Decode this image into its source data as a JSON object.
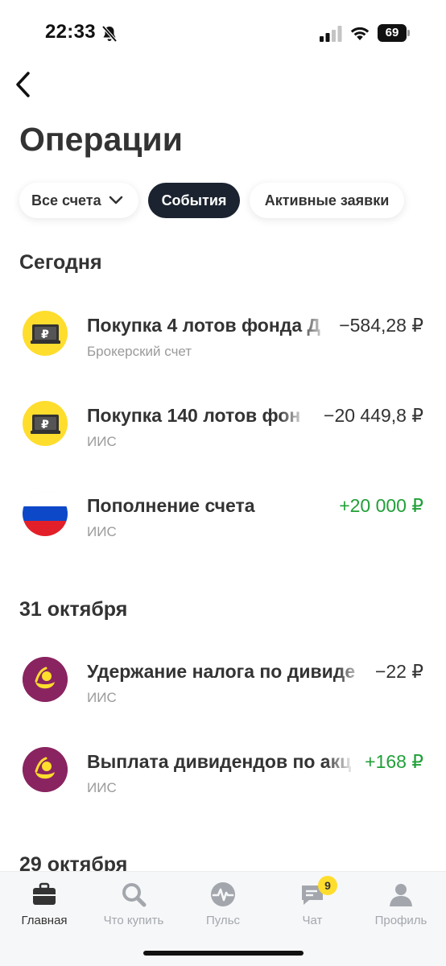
{
  "status_bar": {
    "time": "22:33",
    "battery": "69",
    "icons": [
      "bell-slash-icon",
      "signal-icon",
      "wifi-icon",
      "battery-icon"
    ]
  },
  "header": {
    "back_icon": "chevron-left-icon",
    "title": "Операции"
  },
  "filters": {
    "accounts_label": "Все счета",
    "events_label": "События",
    "orders_label": "Активные заявки",
    "active": "events"
  },
  "sections": [
    {
      "title": "Сегодня",
      "operations": [
        {
          "name": "Покупка 4 лотов фонда Д",
          "account": "Брокерский счет",
          "amount": "−584,28 ₽",
          "direction": "negative",
          "icon": "ruble-wallet-icon"
        },
        {
          "name": "Покупка 140 лотов фон",
          "account": "ИИС",
          "amount": "−20 449,8 ₽",
          "direction": "negative",
          "icon": "ruble-wallet-icon"
        },
        {
          "name": "Пополнение счета",
          "account": "ИИС",
          "amount": "+20 000 ₽",
          "direction": "positive",
          "icon": "russia-flag-icon"
        }
      ]
    },
    {
      "title": "31 октября",
      "operations": [
        {
          "name": "Удержание налога по дивиде",
          "account": "ИИС",
          "amount": "−22 ₽",
          "direction": "negative",
          "icon": "dividend-icon"
        },
        {
          "name": "Выплата дивидендов по акц",
          "account": "ИИС",
          "amount": "+168 ₽",
          "direction": "positive",
          "icon": "dividend-icon"
        }
      ]
    },
    {
      "title": "29 октября",
      "operations": []
    }
  ],
  "tab_bar": {
    "tabs": [
      {
        "label": "Главная",
        "icon": "briefcase-icon",
        "active": true
      },
      {
        "label": "Что купить",
        "icon": "search-icon",
        "active": false
      },
      {
        "label": "Пульс",
        "icon": "pulse-icon",
        "active": false
      },
      {
        "label": "Чат",
        "icon": "chat-icon",
        "active": false,
        "badge": "9"
      },
      {
        "label": "Профиль",
        "icon": "profile-icon",
        "active": false
      }
    ]
  },
  "colors": {
    "accent_yellow": "#ffdd2d",
    "positive": "#21a038",
    "text_primary": "#333333",
    "text_secondary": "#9a9a9a",
    "chip_active": "#1b2330",
    "dividend_icon": "#8a2461"
  }
}
